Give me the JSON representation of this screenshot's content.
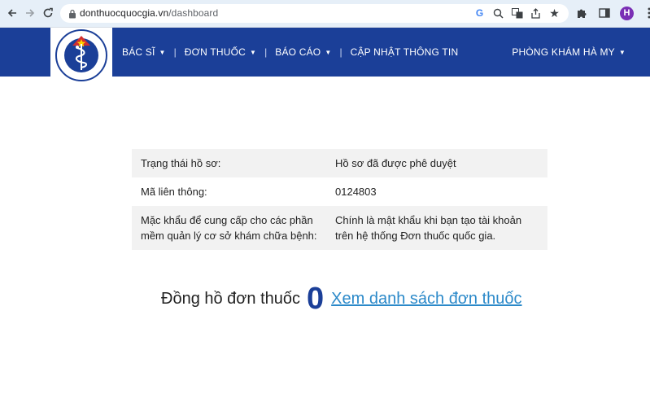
{
  "browser": {
    "url_domain": "donthuocquocgia.vn",
    "url_path": "/dashboard",
    "avatar_letter": "H"
  },
  "header": {
    "logo_text_top": "BỘ Y TẾ",
    "logo_text_bottom": "MINISTRY OF HEALTH",
    "menu": [
      {
        "label": "BÁC SĨ"
      },
      {
        "label": "ĐƠN THUỐC"
      },
      {
        "label": "BÁO CÁO"
      },
      {
        "label": "CẬP NHẬT THÔNG TIN"
      }
    ],
    "clinic_name": "PHÒNG KHÁM HÀ MY"
  },
  "info_table": [
    {
      "label": "Trạng thái hồ sơ:",
      "value": "Hồ sơ đã được phê duyệt"
    },
    {
      "label": "Mã liên thông:",
      "value": "0124803"
    },
    {
      "label": "Mặc khẩu để cung cấp cho các phần mềm quản lý cơ sở khám chữa bệnh:",
      "value": "Chính là mật khẩu khi bạn tạo tài khoản trên hệ thống Đơn thuốc quốc gia."
    }
  ],
  "counter": {
    "label": "Đồng hồ đơn thuốc",
    "value": "0",
    "link_text": "Xem danh sách đơn thuốc"
  },
  "colors": {
    "header_bg": "#1b3f98",
    "link": "#2b89c9",
    "counter_value": "#1b3f98"
  }
}
